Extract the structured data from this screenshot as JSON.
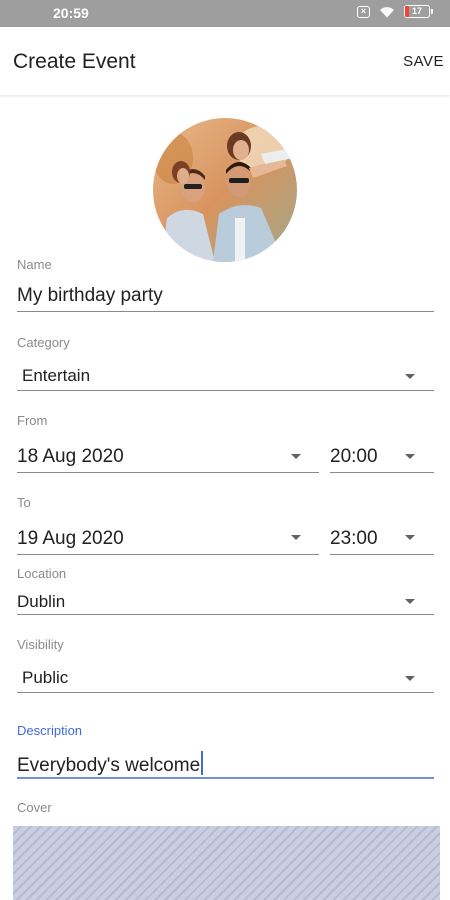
{
  "status_bar": {
    "time": "20:59",
    "battery_level": "17",
    "battery_fraction": 0.17,
    "icons": [
      "notification-x-icon",
      "wifi-icon",
      "battery-icon"
    ]
  },
  "app_bar": {
    "title": "Create Event",
    "save_label": "SAVE"
  },
  "form": {
    "name": {
      "label": "Name",
      "value": "My birthday party"
    },
    "category": {
      "label": "Category",
      "value": "Entertain"
    },
    "from": {
      "label": "From",
      "date": "18 Aug 2020",
      "time": "20:00"
    },
    "to": {
      "label": "To",
      "date": "19 Aug 2020",
      "time": "23:00"
    },
    "location": {
      "label": "Location",
      "value": "Dublin"
    },
    "visibility": {
      "label": "Visibility",
      "value": "Public"
    },
    "description": {
      "label": "Description",
      "value": "Everybody's welcome"
    },
    "cover": {
      "label": "Cover"
    }
  },
  "colors": {
    "status_bar": "#9e9e9e",
    "accent": "#3f6ad8",
    "label_gray": "#8a8a8a",
    "cover_stripes": "#c9cfe0"
  }
}
